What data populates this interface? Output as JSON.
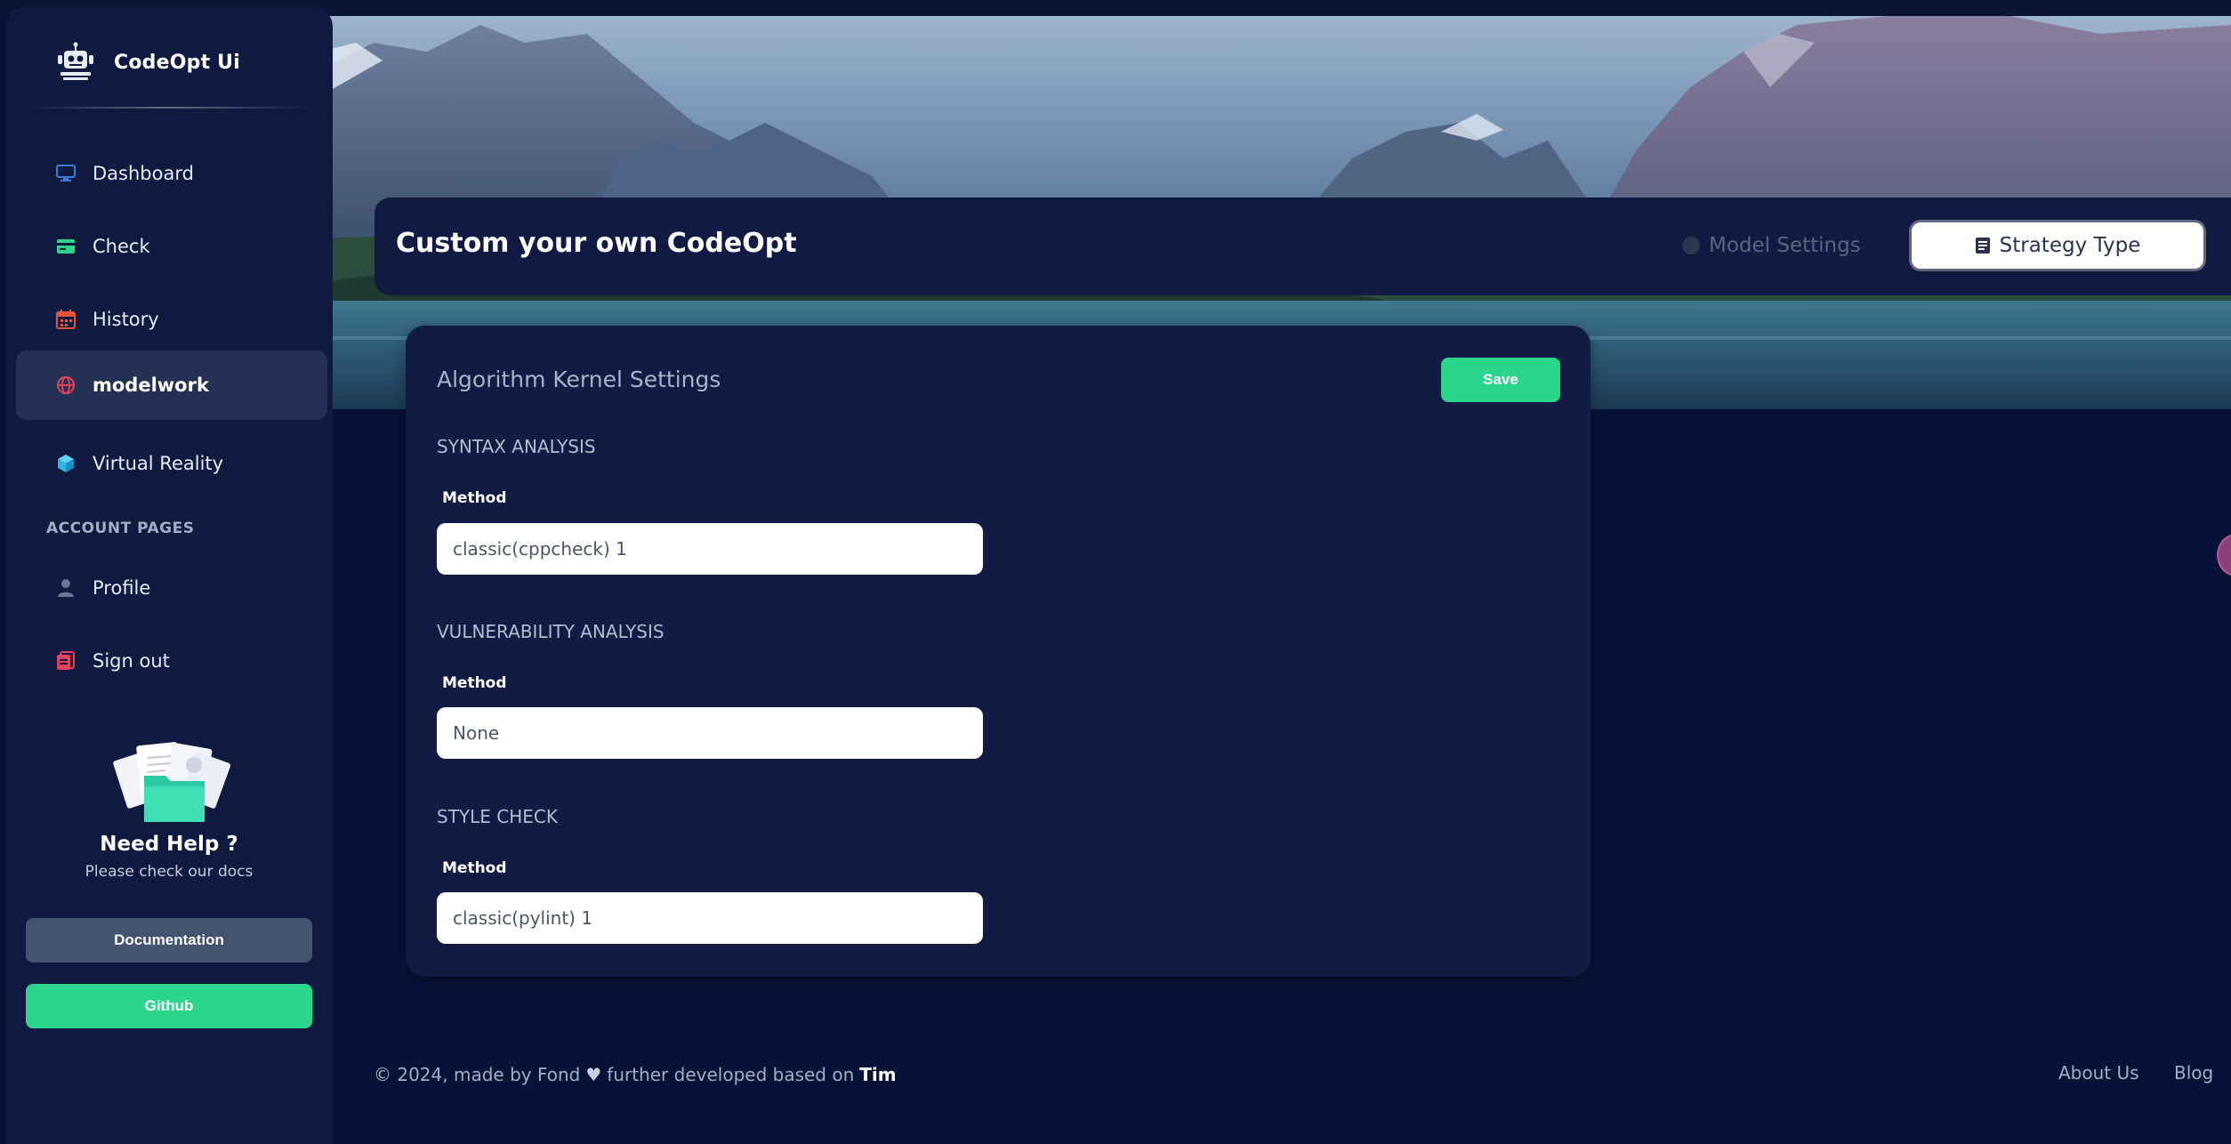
{
  "brand": {
    "name": "CodeOpt Ui",
    "logo_icon": "robot-logo-icon"
  },
  "sidebar": {
    "items": [
      {
        "label": "Dashboard",
        "icon": "monitor-icon",
        "color": "#3b7bd8"
      },
      {
        "label": "Check",
        "icon": "credit-card-icon",
        "color": "#2cd58c"
      },
      {
        "label": "History",
        "icon": "calendar-icon",
        "color": "#e2543c"
      },
      {
        "label": "modelwork",
        "icon": "globe-icon",
        "color": "#e2415e",
        "active": true
      },
      {
        "label": "Virtual Reality",
        "icon": "cube-icon",
        "color": "#27b6e6"
      }
    ],
    "section_label": "ACCOUNT PAGES",
    "account_items": [
      {
        "label": "Profile",
        "icon": "user-icon",
        "color": "#6a7590"
      },
      {
        "label": "Sign out",
        "icon": "sign-out-icon",
        "color": "#e2415e"
      }
    ],
    "help": {
      "title": "Need Help ?",
      "subtitle": "Please check our docs",
      "docs_button": "Documentation",
      "github_button": "Github"
    }
  },
  "header": {
    "title": "Custom your own CodeOpt",
    "tabs": [
      {
        "label": "Model Settings",
        "active": false
      },
      {
        "label": "Strategy Type",
        "active": true
      }
    ]
  },
  "main": {
    "title": "Algorithm Kernel Settings",
    "save_label": "Save",
    "groups": [
      {
        "title": "SYNTAX ANALYSIS",
        "field_label": "Method",
        "value": "classic(cppcheck) 1"
      },
      {
        "title": "VULNERABILITY ANALYSIS",
        "field_label": "Method",
        "value": "None"
      },
      {
        "title": "STYLE CHECK",
        "field_label": "Method",
        "value": "classic(pylint) 1"
      }
    ]
  },
  "footer": {
    "text_prefix": "© 2024, made by Fond",
    "text_middle": "further developed based on",
    "author": "Tim",
    "links": [
      "About Us",
      "Blog"
    ]
  },
  "colors": {
    "accent_green": "#2cd58c",
    "background": "#081238",
    "card": "#111b43"
  }
}
